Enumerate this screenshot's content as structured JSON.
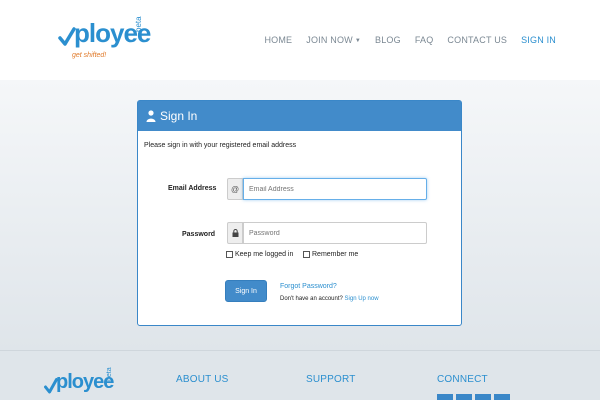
{
  "header": {
    "logo": {
      "wordmark": "ployee",
      "beta": "beta",
      "tagline": "get shifted!"
    },
    "nav": [
      {
        "label": "HOME"
      },
      {
        "label": "JOIN NOW"
      },
      {
        "label": "BLOG"
      },
      {
        "label": "FAQ"
      },
      {
        "label": "CONTACT US"
      },
      {
        "label": "SIGN IN"
      }
    ]
  },
  "signin": {
    "title": "Sign In",
    "intro": "Please sign in with your registered email address",
    "email_label": "Email Address",
    "email_addon": "@",
    "email_placeholder": "Email Address",
    "password_label": "Password",
    "password_placeholder": "Password",
    "keep_logged_in": "Keep me logged in",
    "remember_me": "Remember me",
    "button": "Sign In",
    "forgot": "Forgot Password?",
    "no_account": "Don't have an account?",
    "signup": "Sign Up now"
  },
  "footer": {
    "logo": {
      "wordmark": "ployee",
      "beta": "beta"
    },
    "about": "ABOUT US",
    "support": "SUPPORT",
    "connect": "CONNECT"
  },
  "colors": {
    "accent": "#2b8fcf",
    "panel_heading": "#428bca",
    "tagline": "#e07a2a"
  }
}
